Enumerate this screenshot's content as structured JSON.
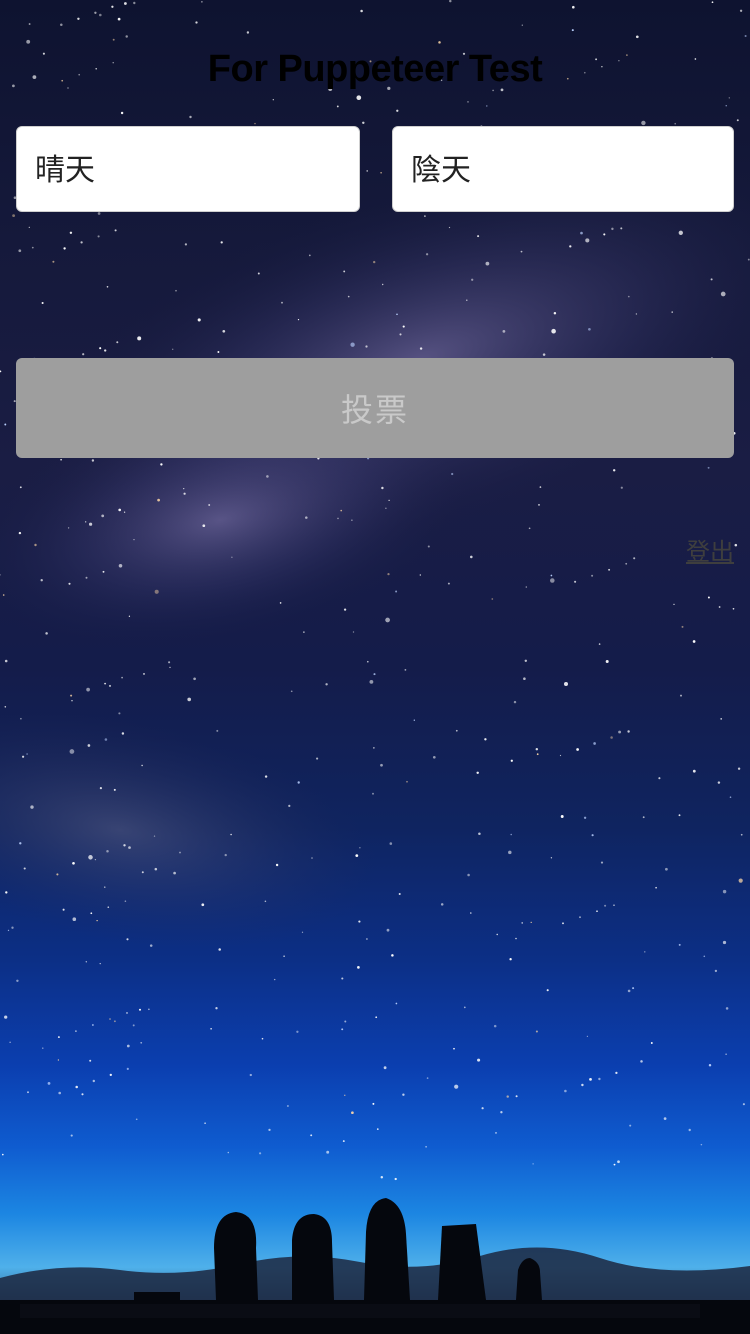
{
  "header": {
    "title": "For Puppeteer Test"
  },
  "options": {
    "left_label": "晴天",
    "right_label": "陰天"
  },
  "actions": {
    "vote_label": "投票",
    "logout_label": "登出"
  },
  "colors": {
    "vote_button_bg": "#9e9e9e",
    "vote_button_text": "#c9c9c9",
    "option_bg": "#ffffff",
    "title_text": "#000000"
  }
}
